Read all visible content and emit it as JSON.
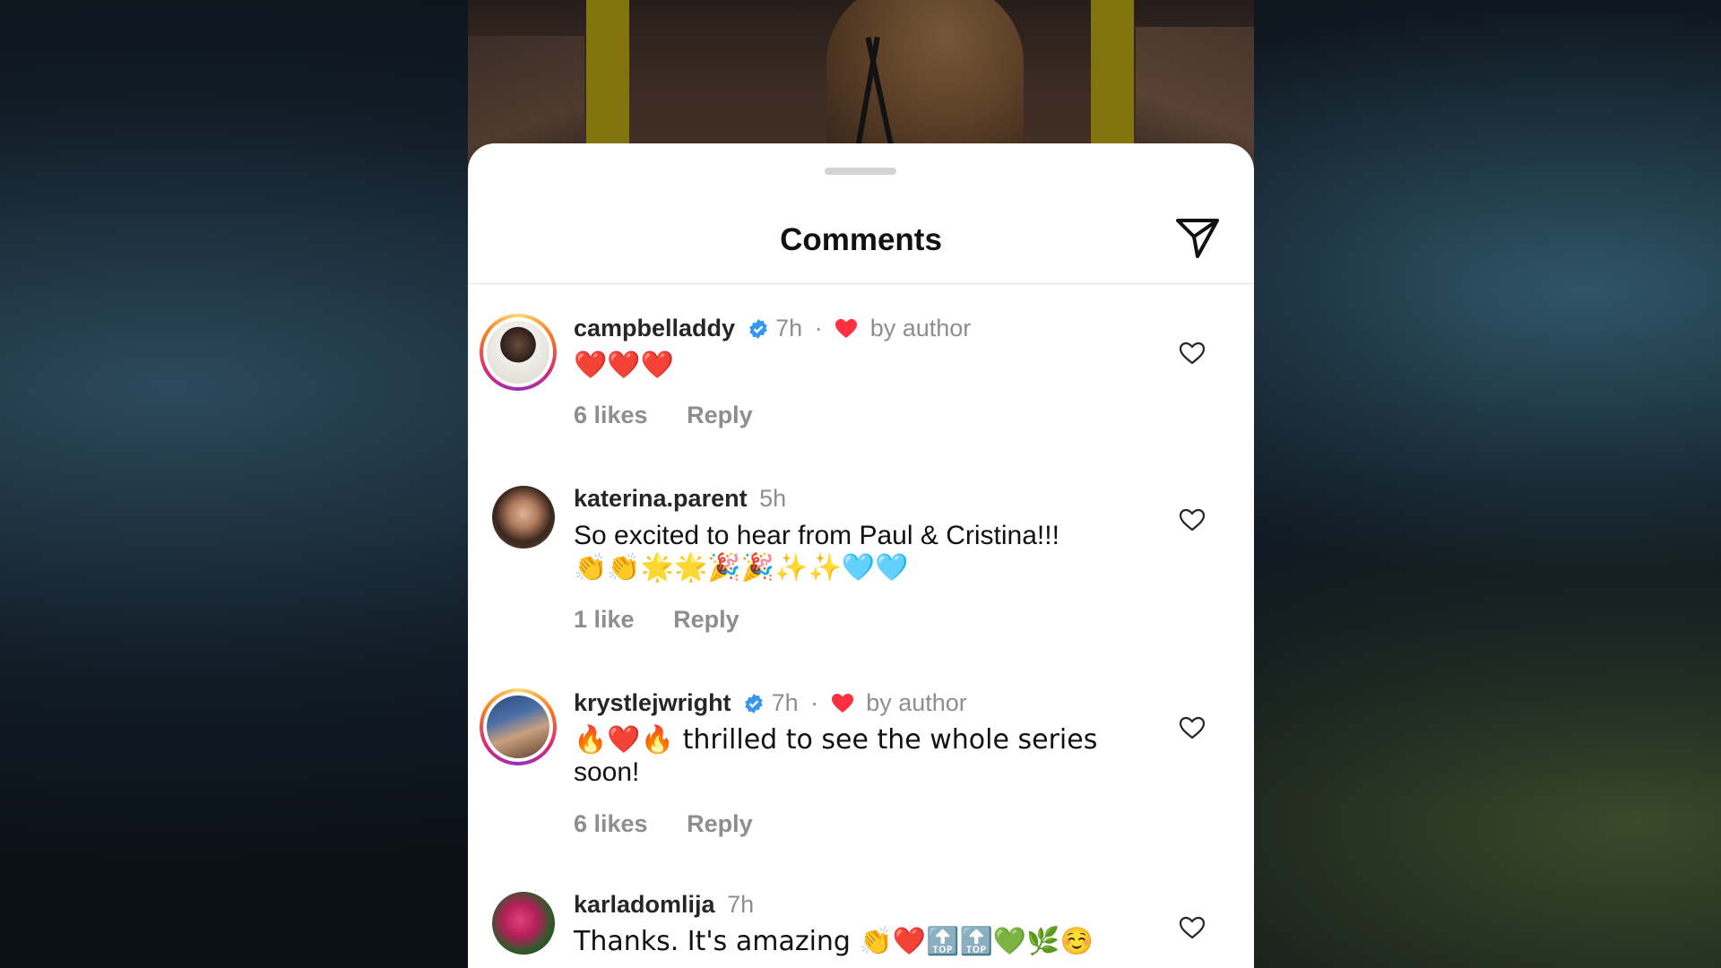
{
  "sheet": {
    "title": "Comments"
  },
  "comments": [
    {
      "username": "campbelladdy",
      "verified": true,
      "time": "7h",
      "author_label": "by author",
      "text": "❤️❤️❤️",
      "likes": "6 likes",
      "reply": "Reply"
    },
    {
      "username": "katerina.parent",
      "verified": false,
      "time": "5h",
      "text": "So excited to hear from Paul & Cristina!!!",
      "text2": "👏👏🌟🌟🎉🎉✨✨🩵🩵",
      "likes": "1 like",
      "reply": "Reply"
    },
    {
      "username": "krystlejwright",
      "verified": true,
      "time": "7h",
      "author_label": "by author",
      "text": "🔥❤️🔥 thrilled to see the whole series",
      "text2": "soon!",
      "likes": "6 likes",
      "reply": "Reply"
    },
    {
      "username": "karladomlija",
      "verified": false,
      "time": "7h",
      "text": "Thanks. It's amazing 👏❤️🔝🔝💚🌿☺️"
    }
  ],
  "colors": {
    "verified_blue": "#3797f0",
    "heart_red": "#ff3040",
    "secondary_text": "#8e8e8e"
  },
  "icons": [
    "send-icon",
    "verified-badge-icon",
    "heart-icon",
    "like-heart-icon"
  ]
}
